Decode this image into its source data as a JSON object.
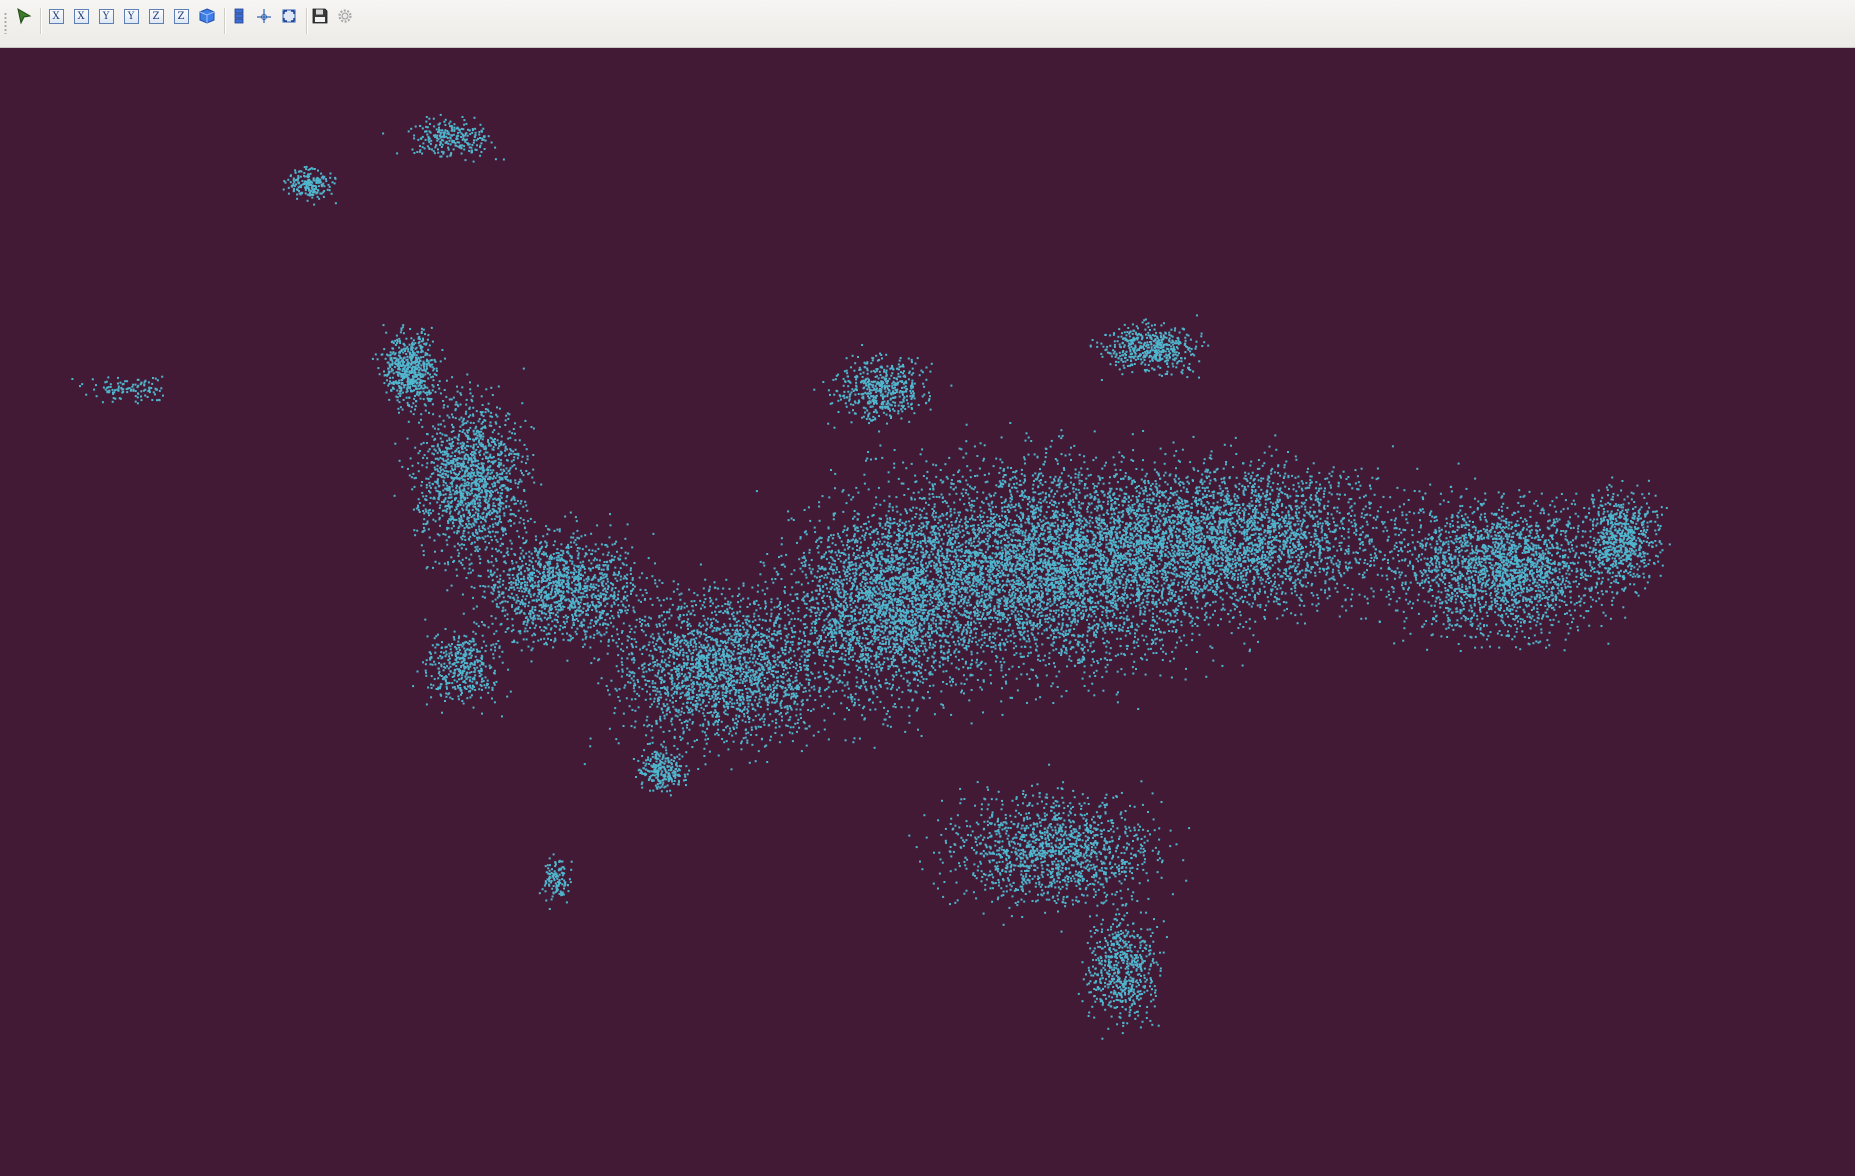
{
  "toolbar": {
    "items": [
      {
        "id": "select",
        "icon": "select-arrow-icon"
      },
      {
        "id": "view-x-pos",
        "label": "X"
      },
      {
        "id": "view-x-neg",
        "label": "X"
      },
      {
        "id": "view-y-pos",
        "label": "Y"
      },
      {
        "id": "view-y-neg",
        "label": "Y"
      },
      {
        "id": "view-z-pos",
        "label": "Z"
      },
      {
        "id": "view-z-neg",
        "label": "Z"
      },
      {
        "id": "view-iso",
        "icon": "cube-icon"
      },
      {
        "id": "toggle-panel",
        "icon": "stack-icon"
      },
      {
        "id": "center",
        "icon": "crosshair-icon"
      },
      {
        "id": "fit-all",
        "icon": "fit-view-icon"
      },
      {
        "id": "save",
        "icon": "floppy-disk-icon"
      },
      {
        "id": "settings",
        "icon": "gear-icon"
      }
    ]
  },
  "viewport": {
    "background_color": "#431a36",
    "point_color": "#4fb6cd",
    "content": "point-cloud"
  }
}
